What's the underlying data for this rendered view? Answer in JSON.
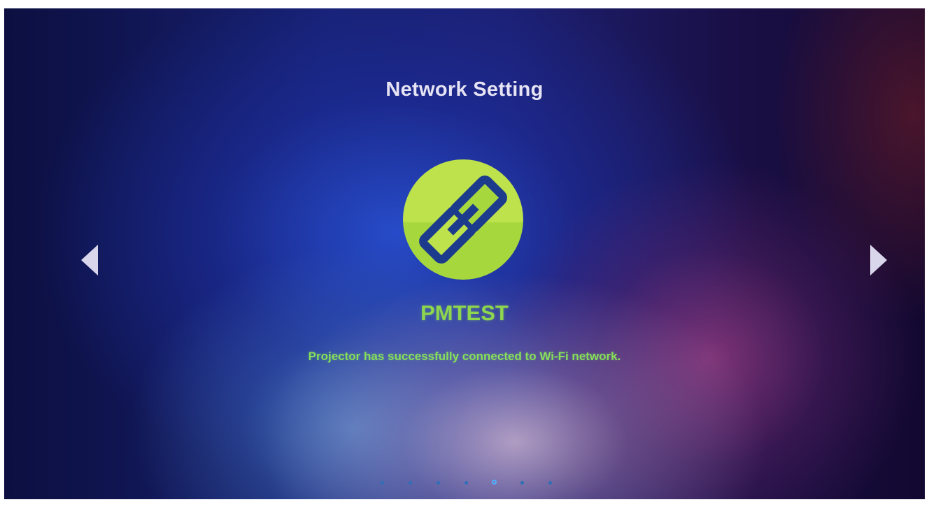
{
  "screen": {
    "title": "Network Setting",
    "network_name": "PMTEST",
    "status_message": "Projector has successfully connected to Wi-Fi network.",
    "icon": "link-icon",
    "icon_color": "#b5e04a",
    "text_accent_color": "#8ed64e"
  },
  "navigation": {
    "previous_icon": "triangle-left-icon",
    "next_icon": "triangle-right-icon"
  },
  "pagination": {
    "total_pages": 7,
    "current_page": 5
  }
}
